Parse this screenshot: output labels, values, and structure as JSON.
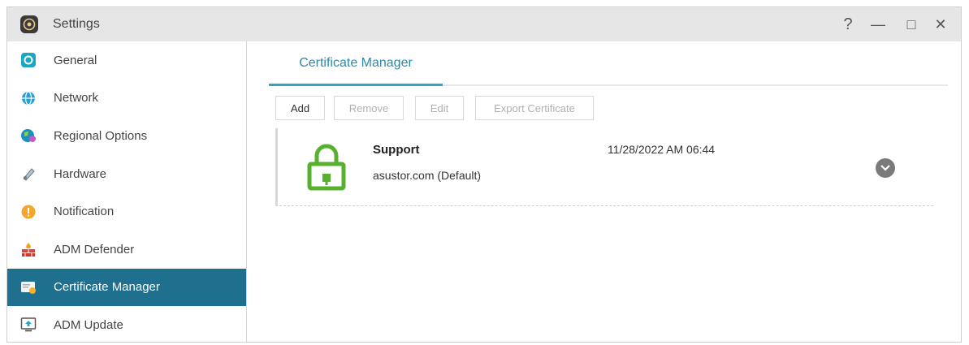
{
  "window": {
    "title": "Settings",
    "controls": {
      "help": "?",
      "minimize": "—",
      "maximize": "□",
      "close": "✕"
    }
  },
  "sidebar": {
    "items": [
      {
        "label": "General",
        "icon": "general-icon"
      },
      {
        "label": "Network",
        "icon": "globe-icon"
      },
      {
        "label": "Regional Options",
        "icon": "globe-pin-icon"
      },
      {
        "label": "Hardware",
        "icon": "hardware-icon"
      },
      {
        "label": "Notification",
        "icon": "alert-icon"
      },
      {
        "label": "ADM Defender",
        "icon": "firewall-icon"
      },
      {
        "label": "Certificate Manager",
        "icon": "certificate-icon",
        "active": true
      },
      {
        "label": "ADM Update",
        "icon": "update-icon"
      }
    ]
  },
  "main": {
    "tab": "Certificate Manager",
    "toolbar": {
      "add": "Add",
      "remove": "Remove",
      "edit": "Edit",
      "export": "Export Certificate"
    },
    "certificates": [
      {
        "name": "Support",
        "domain": "asustor.com (Default)",
        "date": "11/28/2022 AM 06:44",
        "icon": "lock-icon"
      }
    ]
  },
  "colors": {
    "accent": "#2fa6c2",
    "active_sidebar": "#1f6f8f",
    "lock_green": "#57b12e"
  }
}
